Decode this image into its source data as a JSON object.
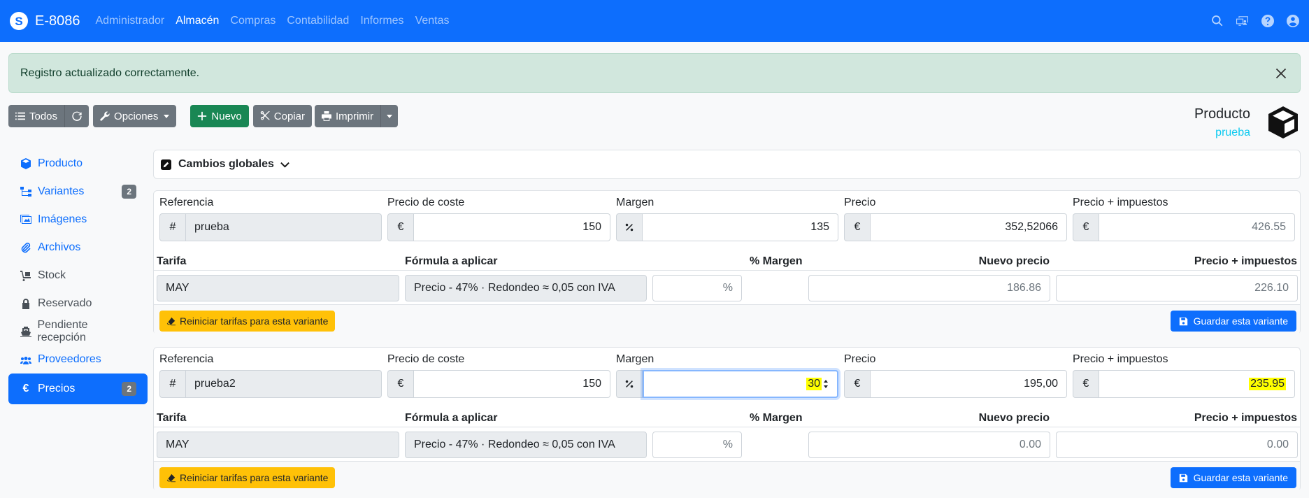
{
  "navbar": {
    "brand": "E-8086",
    "links": [
      "Administrador",
      "Almacén",
      "Compras",
      "Contabilidad",
      "Informes",
      "Ventas"
    ],
    "active": "Almacén",
    "icons": [
      "search-icon",
      "desktop-user-icon",
      "help-icon",
      "user-icon"
    ]
  },
  "alert": {
    "message": "Registro actualizado correctamente."
  },
  "toolbar": {
    "todos": "Todos",
    "opciones": "Opciones",
    "nuevo": "Nuevo",
    "copiar": "Copiar",
    "imprimir": "Imprimir"
  },
  "header": {
    "title": "Producto",
    "subtitle": "prueba"
  },
  "sidebar": {
    "items": [
      {
        "label": "Producto",
        "icon": "cube-icon"
      },
      {
        "label": "Variantes",
        "icon": "sitemap-icon",
        "badge": "2"
      },
      {
        "label": "Imágenes",
        "icon": "images-icon"
      },
      {
        "label": "Archivos",
        "icon": "paperclip-icon"
      },
      {
        "label": "Stock",
        "icon": "dolly-icon"
      },
      {
        "label": "Reservado",
        "icon": "lock-icon"
      },
      {
        "label": "Pendiente recepción",
        "icon": "ship-icon"
      },
      {
        "label": "Proveedores",
        "icon": "users-icon"
      },
      {
        "label": "Precios",
        "icon": "euro-icon",
        "badge": "2"
      }
    ]
  },
  "global_changes": {
    "title": "Cambios globales"
  },
  "labels": {
    "referencia": "Referencia",
    "precio_coste": "Precio de coste",
    "margen": "Margen",
    "precio": "Precio",
    "precio_impuestos": "Precio + impuestos",
    "tarifa": "Tarifa",
    "formula": "Fórmula a aplicar",
    "pct_margen": "% Margen",
    "nuevo_precio": "Nuevo precio",
    "precio_impuestos_col": "Precio + impuestos",
    "hash": "#",
    "euro": "€",
    "percent_sym": "%",
    "reiniciar": "Reiniciar tarifas para esta variante",
    "guardar": "Guardar esta variante"
  },
  "variants": [
    {
      "referencia": "prueba",
      "precio_coste": "150",
      "margen": "135",
      "precio": "352,52066",
      "precio_impuestos": "426.55",
      "tarifa": {
        "name": "MAY",
        "formula": "Precio - 47% · Redondeo ≈ 0,05 con IVA",
        "nuevo_precio": "186.86",
        "precio_impuestos": "226.10"
      }
    },
    {
      "referencia": "prueba2",
      "precio_coste": "150",
      "margen": "30",
      "precio": "195,00",
      "precio_impuestos": "235.95",
      "tarifa": {
        "name": "MAY",
        "formula": "Precio - 47% · Redondeo ≈ 0,05 con IVA",
        "nuevo_precio": "0.00",
        "precio_impuestos": "0.00"
      }
    }
  ]
}
